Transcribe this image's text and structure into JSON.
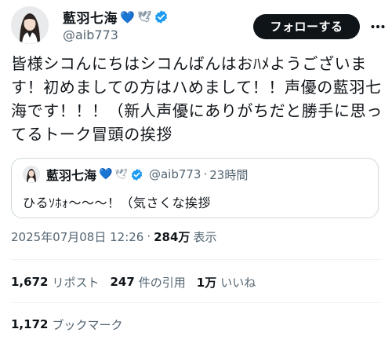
{
  "author": {
    "name": "藍羽七海",
    "handle": "@aib773",
    "emoji_heart": "💙",
    "emoji_dove": "🕊"
  },
  "follow_label": "フォローする",
  "tweet_text": "皆様シコんにちはシコんばんはおﾊﾒようございます！初めましての方はハめまして！！声優の藍羽七海です！！！（新人声優にありがちだと勝手に思ってるトーク冒頭の挨拶",
  "quote": {
    "name": "藍羽七海",
    "handle": "@aib773",
    "separator": "·",
    "time": "23時間",
    "text": "ひるｿﾎｫ〜〜〜！（気さくな挨拶"
  },
  "meta": {
    "datetime": "2025年07月08日 12:26",
    "separator": "·",
    "views": "284万",
    "views_label": "表示"
  },
  "stats": {
    "reposts": "1,672",
    "reposts_label": "リポスト",
    "quotes": "247",
    "quotes_label": "件の引用",
    "likes": "1万",
    "likes_label": "いいね",
    "bookmarks": "1,172",
    "bookmarks_label": "ブックマーク"
  },
  "colors": {
    "text": "#0f1419",
    "secondary": "#536471",
    "verified": "#1d9bf0",
    "border": "#cfd9de"
  }
}
